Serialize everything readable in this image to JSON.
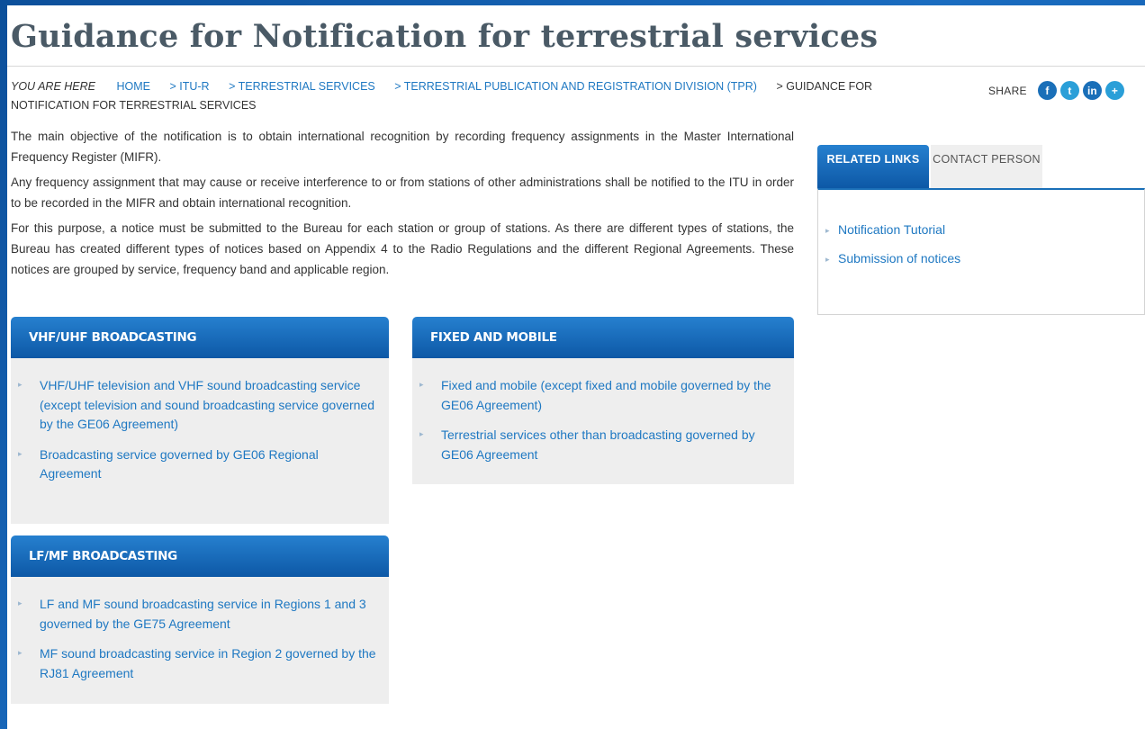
{
  "title": "Guidance for Notification for terrestrial services",
  "breadcrumb": {
    "you_are_here": "YOU ARE HERE",
    "items": [
      "HOME",
      "> ITU-R",
      "> TERRESTRIAL SERVICES",
      "> TERRESTRIAL PUBLICATION AND REGISTRATION DIVISION (TPR)",
      "> GUIDANCE FOR NOTIFICATION FOR TERRESTRIAL SERVICES"
    ]
  },
  "share": {
    "label": "SHARE",
    "icons": [
      {
        "name": "facebook-icon",
        "glyph": "f"
      },
      {
        "name": "twitter-icon",
        "glyph": "t"
      },
      {
        "name": "linkedin-icon",
        "glyph": "in"
      },
      {
        "name": "more-share-icon",
        "glyph": "+"
      }
    ]
  },
  "intro": [
    "The main objective of the notification is to obtain international recognition by recording frequency assignments in the Master International Frequency Register (MIFR).",
    "Any frequency assignment that may cause or receive interference to or from stations of other administrations shall be notified to the ITU in order to be recorded in the MIFR and obtain international recognition.",
    "For this purpose, a notice must be submitted to the Bureau for each station or group of stations. As there are different types of stations, the Bureau has created different types of notices based on Appendix 4 to the Radio Regulations and the different Regional Agreements. These notices are grouped by service, frequency band and applicable region."
  ],
  "panels": {
    "vhf": {
      "title": "VHF/UHF BROADCASTING",
      "items": [
        "VHF/UHF television and VHF sound broadcasting service (except television and sound broadcasting service governed by the GE06 Agreement)",
        "Broadcasting service governed by GE06 Regional Agreement"
      ]
    },
    "fixed": {
      "title": "FIXED AND MOBILE",
      "items": [
        "Fixed and mobile (except fixed and mobile governed by the GE06 Agreement)",
        "Terrestrial services other than broadcasting governed by GE06 Agreement"
      ]
    },
    "lfmf": {
      "title": "LF/MF BROADCASTING",
      "items": [
        "LF and MF sound broadcasting service in  Regions 1 and 3 governed by the GE75  Agreement",
        "MF sound broadcasting service in Region 2 governed by the RJ81 Agreement"
      ]
    }
  },
  "sidebar": {
    "tabs": [
      "RELATED LINKS",
      "CONTACT PERSON"
    ],
    "links": [
      "Notification Tutorial",
      "Submission of notices"
    ]
  },
  "colors": {
    "accent": "#1a6fb8",
    "link": "#1e78c2",
    "panel_bg": "#eeeeee"
  }
}
